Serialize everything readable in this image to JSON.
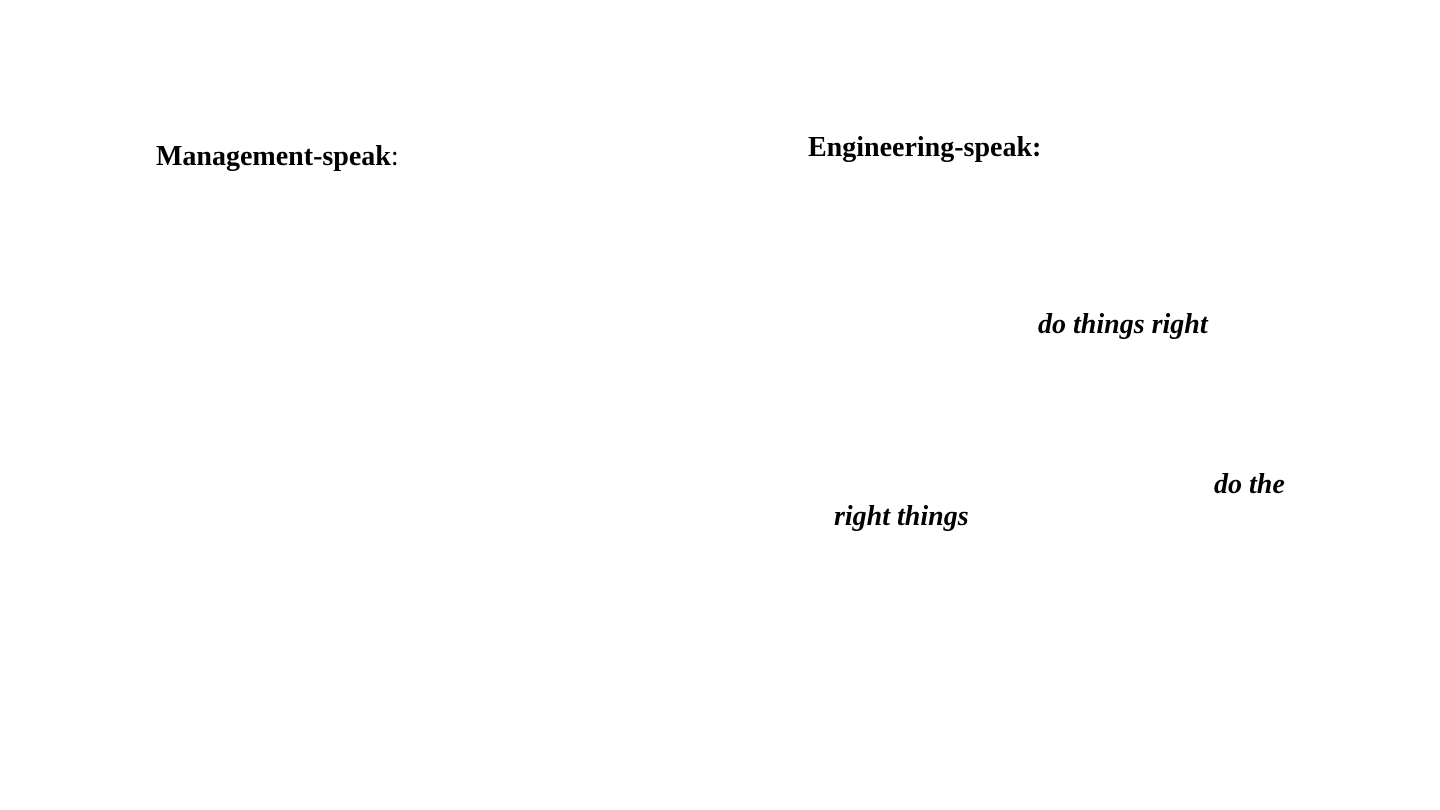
{
  "left_column": {
    "heading": "Management-speak",
    "heading_colon": ":"
  },
  "right_column": {
    "heading": "Engineering-speak:",
    "phrase_1": "do things right",
    "phrase_2_part1": "do the",
    "phrase_2_part2": "right things"
  }
}
